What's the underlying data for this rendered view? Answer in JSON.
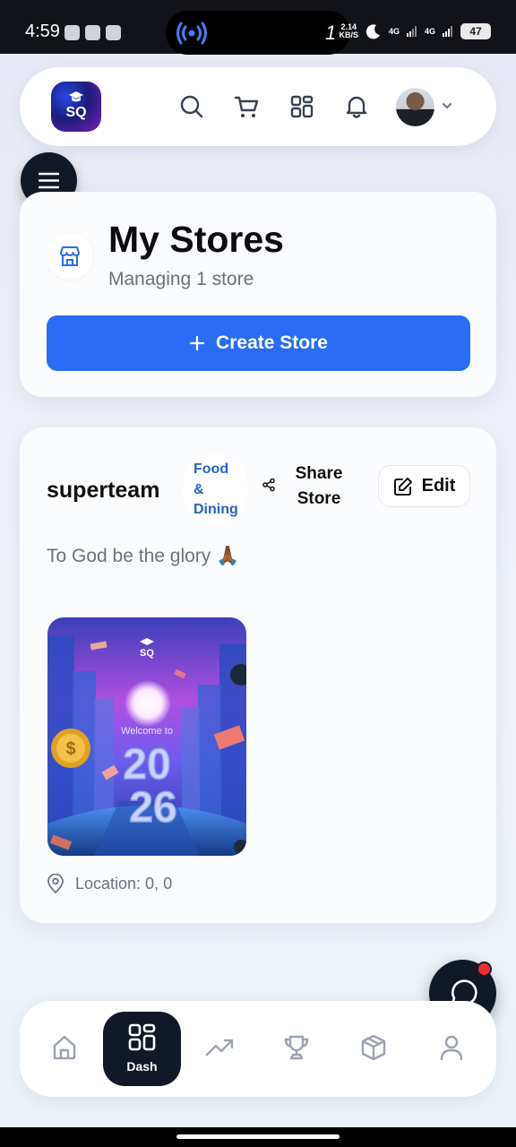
{
  "status_bar": {
    "time": "4:59",
    "island_number": "1",
    "speed_value": "2.14",
    "speed_unit": "KB/S",
    "network_1": "4G",
    "network_2": "4G",
    "battery": "47"
  },
  "header": {
    "logo_text": "SQ"
  },
  "stores_section": {
    "title": "My Stores",
    "subtitle": "Managing 1 store",
    "create_button": "Create Store"
  },
  "store": {
    "name": "superteam",
    "category": "Food & Dining",
    "share_label": "Share Store",
    "edit_label": "Edit",
    "description": "To God be the glory 🙏🏾",
    "location": "Location: 0, 0",
    "image": {
      "logo_text": "SQ",
      "welcome_text": "Welcome to",
      "year_top": "20",
      "year_bottom": "26"
    }
  },
  "bottom_nav": {
    "active_label": "Dash"
  },
  "colors": {
    "primary": "#2a6df4",
    "dark": "#111827",
    "category": "#2563c9",
    "notification": "#ef2d35"
  }
}
